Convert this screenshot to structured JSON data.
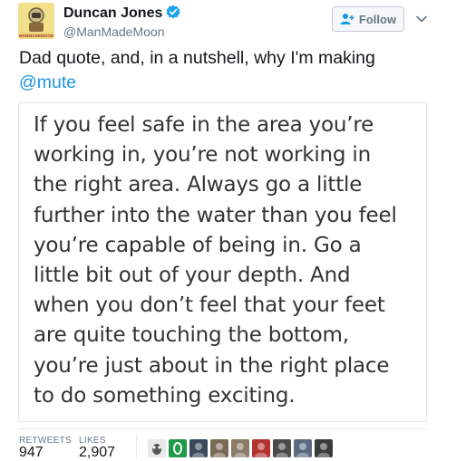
{
  "header": {
    "display_name": "Duncan Jones",
    "handle": "@ManMadeMoon",
    "follow_label": "Follow",
    "avatar_caption": "MANMADEMOON"
  },
  "tweet": {
    "text": "Dad quote, and, in a nutshell, why I'm making ",
    "mention": "@mute"
  },
  "quote": {
    "text": "If you feel safe in the area you’re\nworking in, you’re not working in\nthe right area. Always go a little\nfurther into the water than you feel\nyou’re capable of being in. Go a\nlittle bit out of your depth. And\nwhen you don’t feel that your feet\nare quite touching the bottom,\nyou’re just about in the right place\nto do something exciting."
  },
  "stats": {
    "retweets_label": "RETWEETS",
    "retweets_value": "947",
    "likes_label": "LIKES",
    "likes_value": "2,907"
  },
  "likers": [
    {
      "icon": "owl-avatar-icon",
      "color": "#e8e8e8"
    },
    {
      "icon": "green-badge-avatar-icon",
      "color": "#1f9a4a"
    },
    {
      "icon": "photo-avatar-icon",
      "color": "#3a4a5a"
    },
    {
      "icon": "photo-avatar-icon",
      "color": "#7a6a58"
    },
    {
      "icon": "photo-avatar-icon",
      "color": "#8a7a66"
    },
    {
      "icon": "photo-avatar-icon",
      "color": "#b2342e"
    },
    {
      "icon": "photo-avatar-icon",
      "color": "#4a4a4a"
    },
    {
      "icon": "photo-avatar-icon",
      "color": "#5a6a80"
    },
    {
      "icon": "photo-avatar-icon",
      "color": "#3b3b3b"
    }
  ],
  "colors": {
    "link": "#1b95e0",
    "verified": "#1da1f2",
    "muted": "#657786"
  }
}
